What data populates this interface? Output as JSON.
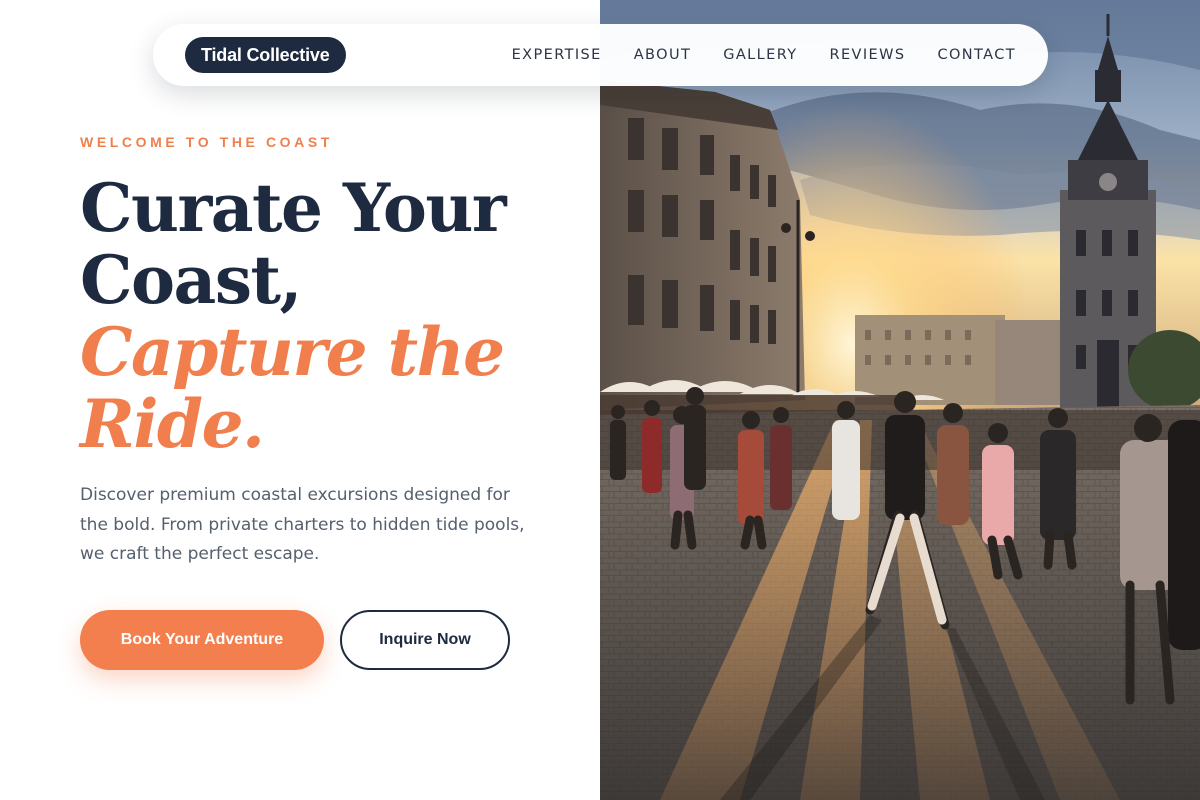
{
  "brand": {
    "name": "Tidal Collective"
  },
  "nav": {
    "links": [
      "EXPERTISE",
      "ABOUT",
      "GALLERY",
      "REVIEWS",
      "CONTACT"
    ]
  },
  "hero": {
    "eyebrow": "WELCOME TO THE COAST",
    "headline_line1": "Curate Your",
    "headline_line2": "Coast,",
    "headline_accent_line1": "Capture the",
    "headline_accent_line2": "Ride.",
    "body": "Discover premium coastal excursions designed for the bold. From private charters to hidden tide pools, we craft the perfect escape.",
    "primary_cta": "Book Your Adventure",
    "secondary_cta": "Inquire Now"
  },
  "colors": {
    "accent": "#f37f4e",
    "navy": "#1d2a3f",
    "body_text": "#55606e"
  },
  "image": {
    "semantic": "town-square-sunset-photo"
  }
}
